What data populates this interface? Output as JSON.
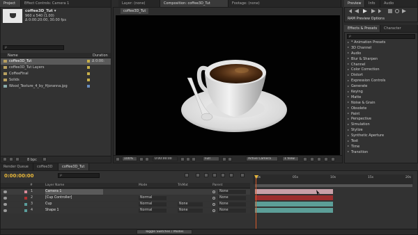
{
  "project_panel": {
    "tabs": [
      "Project",
      "Effect Controls: Camera 1"
    ],
    "comp_name": "coffee3D_Tut ▾",
    "comp_size": "960 x 540 (1.00)",
    "comp_duration": "Δ 0:00:20:00, 30.00 fps",
    "search_placeholder": "ρ",
    "col_name": "Name",
    "col_duration": "Duration",
    "items": [
      {
        "name": "coffee3D_Tut",
        "duration": "Δ 0:00:",
        "color": "#c8b04a",
        "selected": true
      },
      {
        "name": "coffee3D_Tut Layers",
        "duration": "",
        "color": "#c8b04a",
        "selected": false
      },
      {
        "name": "CoffeeFinal",
        "duration": "",
        "color": "#c8b04a",
        "selected": false
      },
      {
        "name": "Solids",
        "duration": "",
        "color": "#c8b04a",
        "selected": false
      },
      {
        "name": "Wood_Texture_4_by_Hjoranna.jpg",
        "duration": "",
        "color": "#6a8fc0",
        "selected": false
      }
    ],
    "bpc": "8 bpc"
  },
  "comp_panel": {
    "tabs": [
      "Layer: (none)",
      "Composition: coffee3D_Tut",
      "Footage: (none)"
    ],
    "subtab": "coffee3D_Tut",
    "zoom": "100%",
    "timecode": "0:00:00:00",
    "resolution": "Full",
    "camera": "Active Camera",
    "views": "1 View"
  },
  "preview_tabs": [
    "Preview",
    "Info",
    "Audio"
  ],
  "ram_preview": "RAM Preview Options",
  "effects_panel": {
    "tabs": [
      "Effects & Presets",
      "Character"
    ],
    "search_placeholder": "ρ",
    "items": [
      "* Animation Presets",
      "3D Channel",
      "Audio",
      "Blur & Sharpen",
      "Channel",
      "Color Correction",
      "Distort",
      "Expression Controls",
      "Generate",
      "Keying",
      "Matte",
      "Noise & Grain",
      "Obsolete",
      "Paint",
      "Perspective",
      "Simulation",
      "Stylize",
      "Synthetic Aperture",
      "Text",
      "Time",
      "Transition"
    ]
  },
  "timeline": {
    "tabs": [
      "Render Queue",
      "coffee3D",
      "coffee3D_Tut"
    ],
    "timecode": "0:00:00:00",
    "search_placeholder": "ρ",
    "headers": {
      "num": "#",
      "layer_name": "Layer Name",
      "mode": "Mode",
      "trkmat": "TrkMat",
      "parent": "Parent"
    },
    "ruler": [
      "00s",
      "05s",
      "10s",
      "15s",
      "20s"
    ],
    "layers": [
      {
        "num": "1",
        "name": "Camera 1",
        "mode": "",
        "trkmat": "",
        "parent": "None",
        "color": "#d88c9a",
        "bar": "#c8a0a8"
      },
      {
        "num": "2",
        "name": "[Cup Controller]",
        "mode": "Normal",
        "trkmat": "",
        "parent": "None",
        "color": "#b03030",
        "bar": "#9c2e2e"
      },
      {
        "num": "3",
        "name": "Cup",
        "mode": "Normal",
        "trkmat": "None",
        "parent": "None",
        "color": "#5a9c9a",
        "bar": "#5c9e98"
      },
      {
        "num": "4",
        "name": "Shape 1",
        "mode": "Normal",
        "trkmat": "None",
        "parent": "None",
        "color": "#5a9c9a",
        "bar": "#5c9e98"
      }
    ],
    "footer": "Toggle Switches / Modes"
  }
}
